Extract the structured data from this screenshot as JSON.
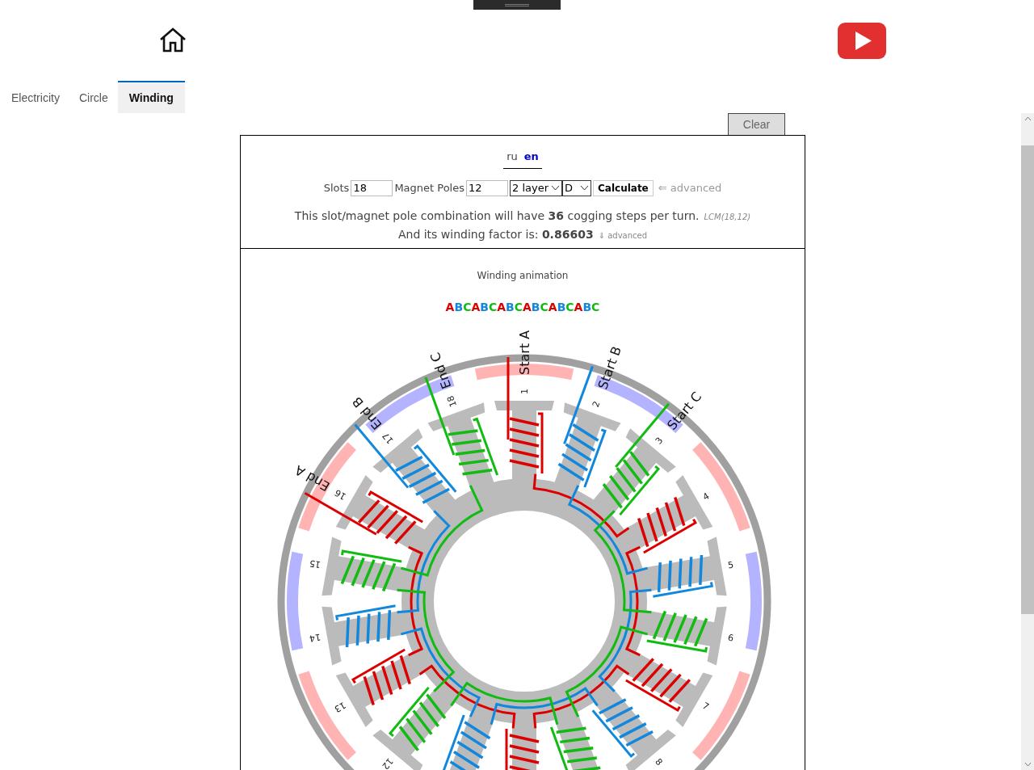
{
  "tabs": [
    {
      "label": "Electricity",
      "selected": false
    },
    {
      "label": "Circle",
      "selected": false
    },
    {
      "label": "Winding",
      "selected": true
    }
  ],
  "clear_button": "Clear",
  "languages": [
    {
      "label": "ru",
      "selected": false
    },
    {
      "label": "en",
      "selected": true
    }
  ],
  "form": {
    "slots_label": "Slots",
    "slots_value": "18",
    "poles_label": "Magnet Poles",
    "poles_value": "12",
    "layer_select": "2 layer",
    "connection_select": "D",
    "calculate_button": "Calculate",
    "advanced_link": "⇐ advanced"
  },
  "result": {
    "cogging_text": "This slot/magnet pole combination will have **36** cogging steps per turn.",
    "lcm_note": "LCM(18,12)",
    "factor_text": "And its winding factor is: **0.86603**",
    "advanced_link": "⇓ advanced"
  },
  "animation": {
    "title": "Winding animation",
    "sequence": [
      {
        "letter": "A",
        "color": "#dd0000"
      },
      {
        "letter": "B",
        "color": "#1188dd"
      },
      {
        "letter": "C",
        "color": "#11bb11"
      },
      {
        "letter": "A",
        "color": "#dd0000"
      },
      {
        "letter": "B",
        "color": "#1188dd"
      },
      {
        "letter": "C",
        "color": "#11bb11"
      },
      {
        "letter": "A",
        "color": "#dd0000"
      },
      {
        "letter": "B",
        "color": "#1188dd"
      },
      {
        "letter": "C",
        "color": "#11bb11"
      },
      {
        "letter": "A",
        "color": "#dd0000"
      },
      {
        "letter": "B",
        "color": "#1188dd"
      },
      {
        "letter": "C",
        "color": "#11bb11"
      },
      {
        "letter": "A",
        "color": "#dd0000"
      },
      {
        "letter": "B",
        "color": "#1188dd"
      },
      {
        "letter": "C",
        "color": "#11bb11"
      },
      {
        "letter": "A",
        "color": "#dd0000"
      },
      {
        "letter": "B",
        "color": "#1188dd"
      },
      {
        "letter": "C",
        "color": "#11bb11"
      }
    ],
    "magnets_clockwise": [
      {
        "color": "#ffb3b3"
      },
      {
        "color": "#b3b3ff"
      },
      {
        "color": "#ffb3b3"
      },
      {
        "color": "#b3b3ff"
      },
      {
        "color": "#ffb3b3"
      }
    ],
    "magnets_counterclockwise": [
      {
        "color": "#b3b3ff"
      },
      {
        "color": "#ffb3b3"
      },
      {
        "color": "#b3b3ff"
      },
      {
        "color": "#ffb3b3"
      }
    ],
    "slots": [
      {
        "number": "1",
        "color": "#dd0000",
        "lead": "Start A"
      },
      {
        "number": "2",
        "color": "#1188dd",
        "lead": "Start B"
      },
      {
        "number": "3",
        "color": "#11bb11",
        "lead": "Start C"
      },
      {
        "number": "4",
        "color": "#dd0000"
      },
      {
        "number": "5",
        "color": "#1188dd"
      },
      {
        "number": "6",
        "color": "#11bb11"
      },
      {
        "number": "7",
        "color": "#dd0000"
      },
      {
        "number": "8",
        "color": "#1188dd"
      },
      {
        "color": "#11bb11"
      },
      {
        "color": "#dd0000"
      },
      {
        "color": "#1188dd"
      },
      {
        "number": "12",
        "color": "#11bb11"
      },
      {
        "number": "13",
        "color": "#dd0000"
      },
      {
        "number": "14",
        "color": "#1188dd"
      },
      {
        "number": "15",
        "color": "#11bb11"
      },
      {
        "number": "16",
        "color": "#dd0000",
        "lead": "End A"
      },
      {
        "number": "17",
        "color": "#1188dd",
        "lead": "End B"
      },
      {
        "number": "18",
        "color": "#11bb11",
        "lead": "End C"
      }
    ]
  }
}
